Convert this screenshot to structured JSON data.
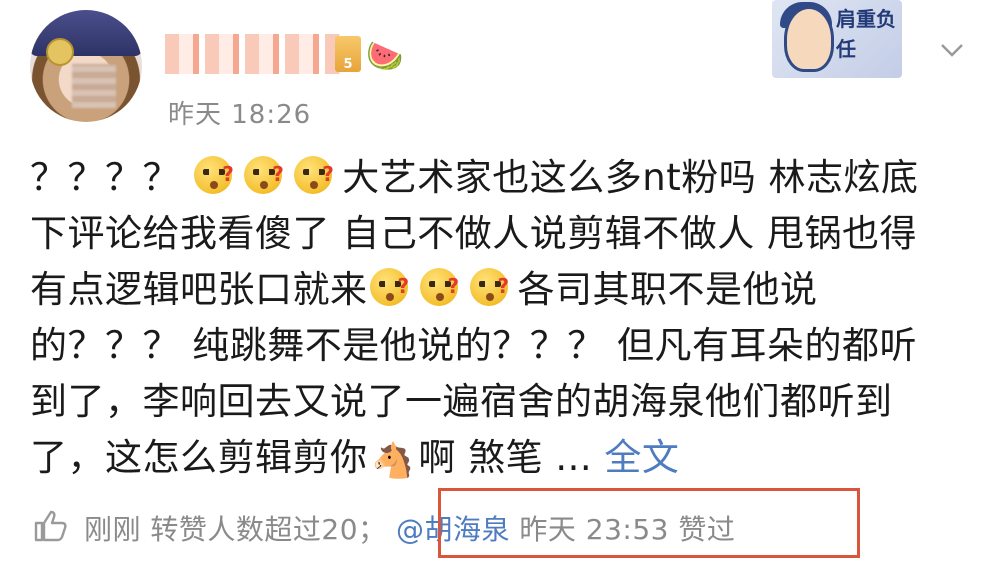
{
  "header": {
    "post_time": "昨天 18:26",
    "vip_level": "5",
    "sticker_text": "肩重负任",
    "icons": {
      "avatar": "avatar",
      "watermelon": "watermelon-icon",
      "chevron": "chevron-down-icon"
    }
  },
  "post": {
    "line1_prefix": "？？？？",
    "line1_text": "大艺术家也这么多nt粉吗 林志炫底",
    "line2": "下评论给我看傻了 自己不做人说剪辑不做人 甩锅也得",
    "line3_prefix": "有点逻辑吧张口就来",
    "line3_suffix": "各司其职不是他说",
    "line4": "的？？？ 纯跳舞不是他说的？？？ 但凡有耳朵的都听",
    "line5": "到了，李响回去又说了一遍宿舍的胡海泉他们都听到",
    "line6_prefix": "了，这怎么剪辑剪你",
    "line6_middle": "啊  煞笔 ...",
    "more_label": "全文",
    "emoji_name": "confused-face-emoji",
    "horse_name": "horse-icon"
  },
  "footer": {
    "time_label": "刚刚",
    "info_text": "转赞人数超过20；",
    "mention": "@胡海泉",
    "liked_text": "昨天 23:53 赞过",
    "like_icon": "like-icon"
  },
  "colors": {
    "link": "#4f7cc0",
    "highlight_border": "#d9553b",
    "muted_text": "#8a8a8a"
  }
}
